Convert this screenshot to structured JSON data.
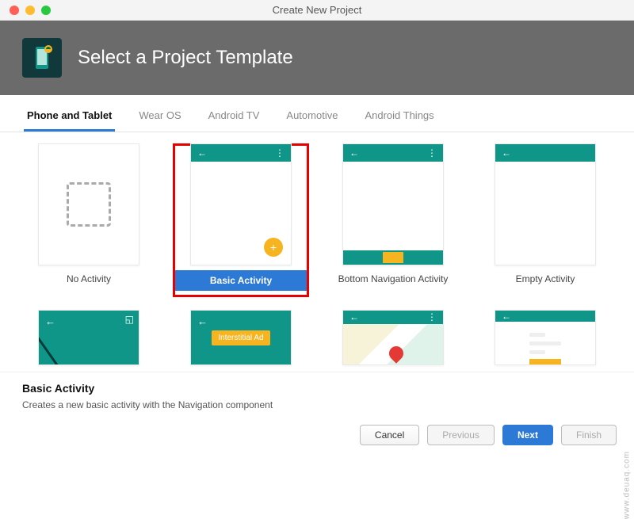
{
  "window": {
    "title": "Create New Project"
  },
  "hero": {
    "title": "Select a Project Template",
    "icon": "android-studio-phone-icon"
  },
  "tabs": [
    {
      "label": "Phone and Tablet",
      "active": true
    },
    {
      "label": "Wear OS",
      "active": false
    },
    {
      "label": "Android TV",
      "active": false
    },
    {
      "label": "Automotive",
      "active": false
    },
    {
      "label": "Android Things",
      "active": false
    }
  ],
  "templates_row1": [
    {
      "label": "No Activity",
      "selected": false,
      "kind": "none"
    },
    {
      "label": "Basic Activity",
      "selected": true,
      "kind": "basic"
    },
    {
      "label": "Bottom Navigation Activity",
      "selected": false,
      "kind": "bottomnav"
    },
    {
      "label": "Empty Activity",
      "selected": false,
      "kind": "empty"
    }
  ],
  "templates_row2": [
    {
      "kind": "fullscreen"
    },
    {
      "kind": "ad",
      "ad_label": "Interstitial Ad"
    },
    {
      "kind": "map"
    },
    {
      "kind": "login"
    }
  ],
  "description": {
    "title": "Basic Activity",
    "text": "Creates a new basic activity with the Navigation component"
  },
  "buttons": {
    "cancel": "Cancel",
    "previous": "Previous",
    "next": "Next",
    "finish": "Finish"
  },
  "watermark": "www.deuaq.com",
  "colors": {
    "teal": "#0f9688",
    "accent": "#f5b420",
    "primary": "#2d7ad6",
    "selectRed": "#e60000"
  }
}
